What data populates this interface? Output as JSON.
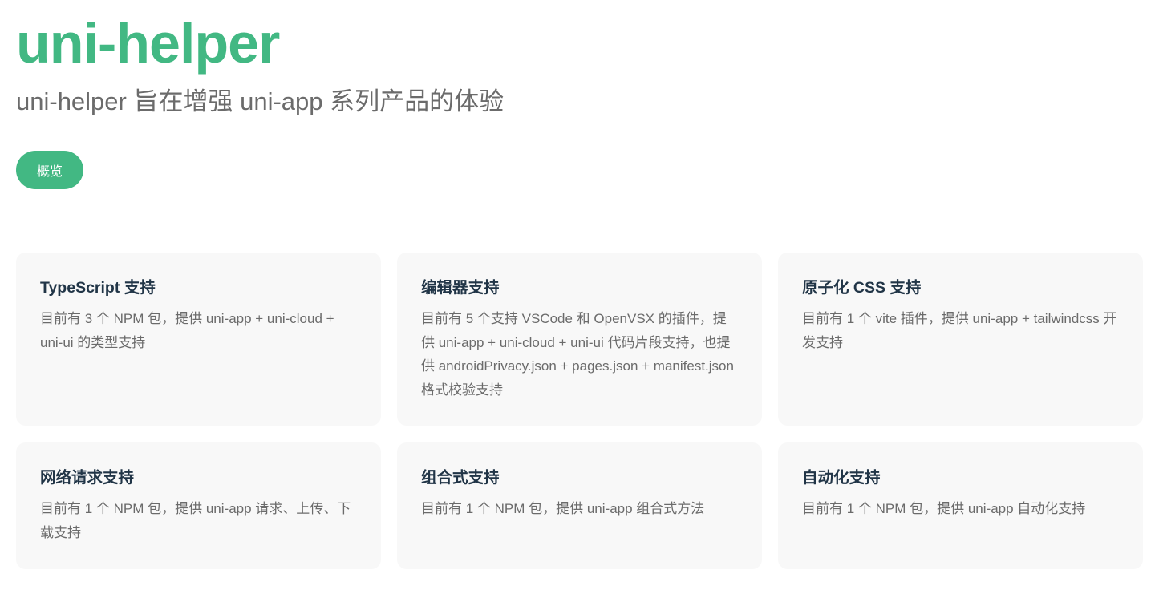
{
  "hero": {
    "title": "uni-helper",
    "tagline": "uni-helper 旨在增强 uni-app 系列产品的体验",
    "action_label": "概览"
  },
  "features": [
    {
      "title": "TypeScript 支持",
      "details": "目前有 3 个 NPM 包，提供 uni-app + uni-cloud + uni-ui 的类型支持"
    },
    {
      "title": "编辑器支持",
      "details": "目前有 5 个支持 VSCode 和 OpenVSX 的插件，提供 uni-app + uni-cloud + uni-ui 代码片段支持，也提供 androidPrivacy.json + pages.json + manifest.json 格式校验支持"
    },
    {
      "title": "原子化 CSS 支持",
      "details": "目前有 1 个 vite 插件，提供 uni-app + tailwindcss 开发支持"
    },
    {
      "title": "网络请求支持",
      "details": "目前有 1 个 NPM 包，提供 uni-app 请求、上传、下载支持"
    },
    {
      "title": "组合式支持",
      "details": "目前有 1 个 NPM 包，提供 uni-app 组合式方法"
    },
    {
      "title": "自动化支持",
      "details": "目前有 1 个 NPM 包，提供 uni-app 自动化支持"
    }
  ],
  "colors": {
    "brand": "#42b883",
    "card_bg": "#f8f8f8",
    "title_text": "#213547",
    "body_text": "#6b6b6b"
  }
}
